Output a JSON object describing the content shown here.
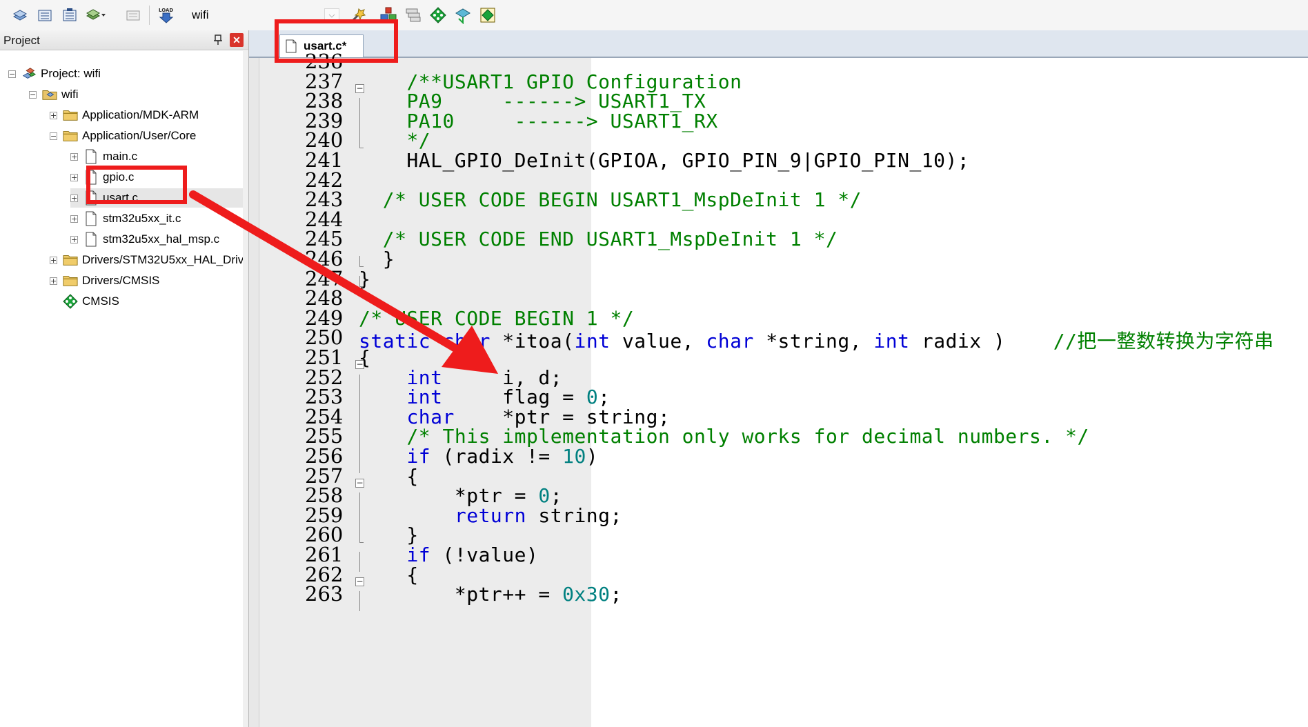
{
  "toolbar": {
    "target_name": "wifi",
    "icons": [
      "translate-icon",
      "build-icon",
      "rebuild-icon",
      "batch-build-icon",
      "stop-build-icon",
      "download-icon",
      "target-options-icon",
      "manage-components-icon",
      "file-extensions-icon",
      "pack-installer-icon",
      "green-diamond-icon",
      "select-software-packs-icon"
    ]
  },
  "project": {
    "title": "Project",
    "tree": [
      {
        "label": "Project: wifi",
        "level": 0,
        "expander": "−",
        "icon": "project-icon"
      },
      {
        "label": "wifi",
        "level": 1,
        "expander": "−",
        "icon": "target-folder-icon"
      },
      {
        "label": "Application/MDK-ARM",
        "level": 2,
        "expander": "+",
        "icon": "folder-icon"
      },
      {
        "label": "Application/User/Core",
        "level": 2,
        "expander": "−",
        "icon": "folder-icon"
      },
      {
        "label": "main.c",
        "level": 3,
        "expander": "+",
        "icon": "file-icon"
      },
      {
        "label": "gpio.c",
        "level": 3,
        "expander": "+",
        "icon": "file-icon"
      },
      {
        "label": "usart.c",
        "level": 3,
        "expander": "+",
        "icon": "file-icon",
        "selected": true
      },
      {
        "label": "stm32u5xx_it.c",
        "level": 3,
        "expander": "+",
        "icon": "file-icon"
      },
      {
        "label": "stm32u5xx_hal_msp.c",
        "level": 3,
        "expander": "+",
        "icon": "file-icon"
      },
      {
        "label": "Drivers/STM32U5xx_HAL_Driv",
        "level": 2,
        "expander": "+",
        "icon": "folder-icon"
      },
      {
        "label": "Drivers/CMSIS",
        "level": 2,
        "expander": "+",
        "icon": "folder-icon"
      },
      {
        "label": "CMSIS",
        "level": 2,
        "expander": "",
        "icon": "cmsis-diamond-icon"
      }
    ]
  },
  "editor": {
    "tabs": [
      {
        "label": "usart.c*",
        "active": true
      }
    ],
    "lines": [
      {
        "n": "236",
        "fold": "",
        "tokens": []
      },
      {
        "n": "237",
        "fold": "box",
        "tokens": [
          [
            "    ",
            ""
          ],
          [
            "/**USART1 GPIO Configuration",
            "cm"
          ]
        ]
      },
      {
        "n": "238",
        "fold": "line",
        "tokens": [
          [
            "    ",
            ""
          ],
          [
            "PA9     ------> USART1_TX",
            "cm"
          ]
        ]
      },
      {
        "n": "239",
        "fold": "line",
        "tokens": [
          [
            "    ",
            ""
          ],
          [
            "PA10     ------> USART1_RX",
            "cm"
          ]
        ]
      },
      {
        "n": "240",
        "fold": "end",
        "tokens": [
          [
            "    ",
            ""
          ],
          [
            "*/",
            "cm"
          ]
        ]
      },
      {
        "n": "241",
        "fold": "",
        "tokens": [
          [
            "    HAL_GPIO_DeInit(GPIOA, GPIO_PIN_9|GPIO_PIN_10);",
            ""
          ]
        ]
      },
      {
        "n": "242",
        "fold": "",
        "tokens": []
      },
      {
        "n": "243",
        "fold": "",
        "tokens": [
          [
            "  ",
            ""
          ],
          [
            "/* USER CODE BEGIN USART1_MspDeInit 1 */",
            "cm"
          ]
        ]
      },
      {
        "n": "244",
        "fold": "",
        "tokens": []
      },
      {
        "n": "245",
        "fold": "",
        "tokens": [
          [
            "  ",
            ""
          ],
          [
            "/* USER CODE END USART1_MspDeInit 1 */",
            "cm"
          ]
        ]
      },
      {
        "n": "246",
        "fold": "end",
        "tokens": [
          [
            "  }",
            ""
          ]
        ]
      },
      {
        "n": "247",
        "fold": "end",
        "tokens": [
          [
            "}",
            ""
          ]
        ]
      },
      {
        "n": "248",
        "fold": "",
        "tokens": []
      },
      {
        "n": "249",
        "fold": "",
        "tokens": [
          [
            "/* USER CODE BEGIN 1 */",
            "cm"
          ]
        ]
      },
      {
        "n": "250",
        "fold": "",
        "tokens": [
          [
            "static",
            "kw"
          ],
          [
            " ",
            ""
          ],
          [
            "char",
            "kw"
          ],
          [
            " *itoa(",
            ""
          ],
          [
            "int",
            "kw"
          ],
          [
            " value, ",
            ""
          ],
          [
            "char",
            "kw"
          ],
          [
            " *string, ",
            ""
          ],
          [
            "int",
            "kw"
          ],
          [
            " radix )    ",
            ""
          ],
          [
            "//把一整数转换为字符串",
            "cm"
          ]
        ]
      },
      {
        "n": "251",
        "fold": "box",
        "tokens": [
          [
            "{",
            ""
          ]
        ]
      },
      {
        "n": "252",
        "fold": "line",
        "tokens": [
          [
            "    ",
            ""
          ],
          [
            "int",
            "kw"
          ],
          [
            "     i, d;",
            ""
          ]
        ]
      },
      {
        "n": "253",
        "fold": "line",
        "tokens": [
          [
            "    ",
            ""
          ],
          [
            "int",
            "kw"
          ],
          [
            "     flag = ",
            ""
          ],
          [
            "0",
            "num"
          ],
          [
            ";",
            ""
          ]
        ]
      },
      {
        "n": "254",
        "fold": "line",
        "tokens": [
          [
            "    ",
            ""
          ],
          [
            "char",
            "kw"
          ],
          [
            "    *ptr = string;",
            ""
          ]
        ]
      },
      {
        "n": "255",
        "fold": "line",
        "tokens": [
          [
            "    ",
            ""
          ],
          [
            "/* This implementation only works for decimal numbers. */",
            "cm"
          ]
        ]
      },
      {
        "n": "256",
        "fold": "line",
        "tokens": [
          [
            "    ",
            ""
          ],
          [
            "if",
            "kw"
          ],
          [
            " (radix != ",
            ""
          ],
          [
            "10",
            "num"
          ],
          [
            ")",
            ""
          ]
        ]
      },
      {
        "n": "257",
        "fold": "box",
        "tokens": [
          [
            "    {",
            ""
          ]
        ]
      },
      {
        "n": "258",
        "fold": "line",
        "tokens": [
          [
            "        *ptr = ",
            ""
          ],
          [
            "0",
            "num"
          ],
          [
            ";",
            ""
          ]
        ]
      },
      {
        "n": "259",
        "fold": "line",
        "tokens": [
          [
            "        ",
            ""
          ],
          [
            "return",
            "kw"
          ],
          [
            " string;",
            ""
          ]
        ]
      },
      {
        "n": "260",
        "fold": "end",
        "tokens": [
          [
            "    }",
            ""
          ]
        ]
      },
      {
        "n": "261",
        "fold": "line",
        "tokens": [
          [
            "    ",
            ""
          ],
          [
            "if",
            "kw"
          ],
          [
            " (!value)",
            ""
          ]
        ]
      },
      {
        "n": "262",
        "fold": "box",
        "tokens": [
          [
            "    {",
            ""
          ]
        ]
      },
      {
        "n": "263",
        "fold": "line",
        "tokens": [
          [
            "        *ptr++ = ",
            ""
          ],
          [
            "0x30",
            "num"
          ],
          [
            ";",
            ""
          ]
        ]
      }
    ]
  },
  "colors": {
    "keyword": "#0000d6",
    "comment": "#008000",
    "number": "#008080",
    "annotation": "#ee1c1c"
  }
}
